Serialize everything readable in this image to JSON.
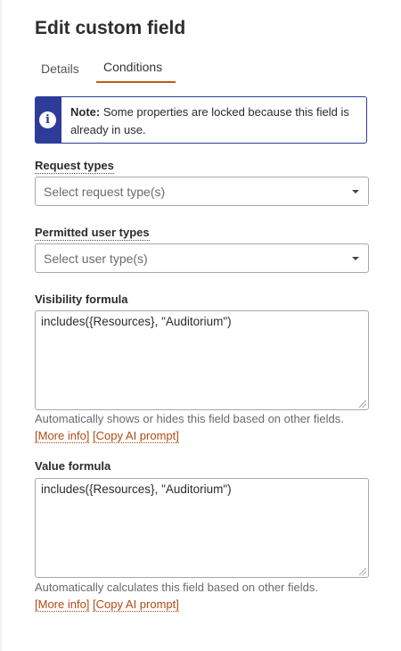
{
  "title": "Edit custom field",
  "tabs": [
    {
      "label": "Details"
    },
    {
      "label": "Conditions"
    }
  ],
  "note": {
    "prefix": "Note:",
    "text": "Some properties are locked because this field is already in use.",
    "icon": "info-icon",
    "color": "#2e3c99"
  },
  "request_types": {
    "label": "Request types",
    "placeholder": "Select request type(s)"
  },
  "permitted_user_types": {
    "label": "Permitted user types",
    "placeholder": "Select user type(s)"
  },
  "visibility_formula": {
    "label": "Visibility formula",
    "value": "includes({Resources}, \"Auditorium\")",
    "help": "Automatically shows or hides this field based on other fields.",
    "more_info": "[More info]",
    "copy_ai": "[Copy AI prompt]"
  },
  "value_formula": {
    "label": "Value formula",
    "value": "includes({Resources}, \"Auditorium\")",
    "help": "Automatically calculates this field based on other fields.",
    "more_info": "[More info]",
    "copy_ai": "[Copy AI prompt]"
  },
  "colors": {
    "accent": "#c45a18",
    "link": "#b04a12",
    "note_border": "#2e3c99"
  }
}
